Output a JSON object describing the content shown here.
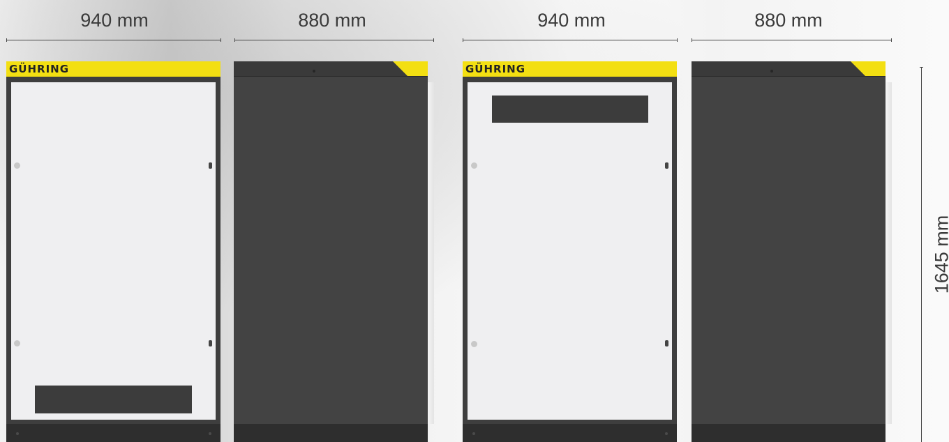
{
  "dimensions": {
    "width_label_1": "940 mm",
    "depth_label_1": "880 mm",
    "width_label_2": "940 mm",
    "depth_label_2": "880 mm",
    "height_label": "1645 mm"
  },
  "cabinets": [
    {
      "brand": "GÜHRING",
      "view": "front",
      "display_slot": "bottom"
    },
    {
      "view": "side"
    },
    {
      "brand": "GÜHRING",
      "view": "front",
      "display_slot": "top"
    },
    {
      "view": "side"
    }
  ],
  "colors": {
    "brand_yellow": "#f3df12",
    "cabinet_dark": "#434343",
    "panel_light": "#efeff1"
  }
}
